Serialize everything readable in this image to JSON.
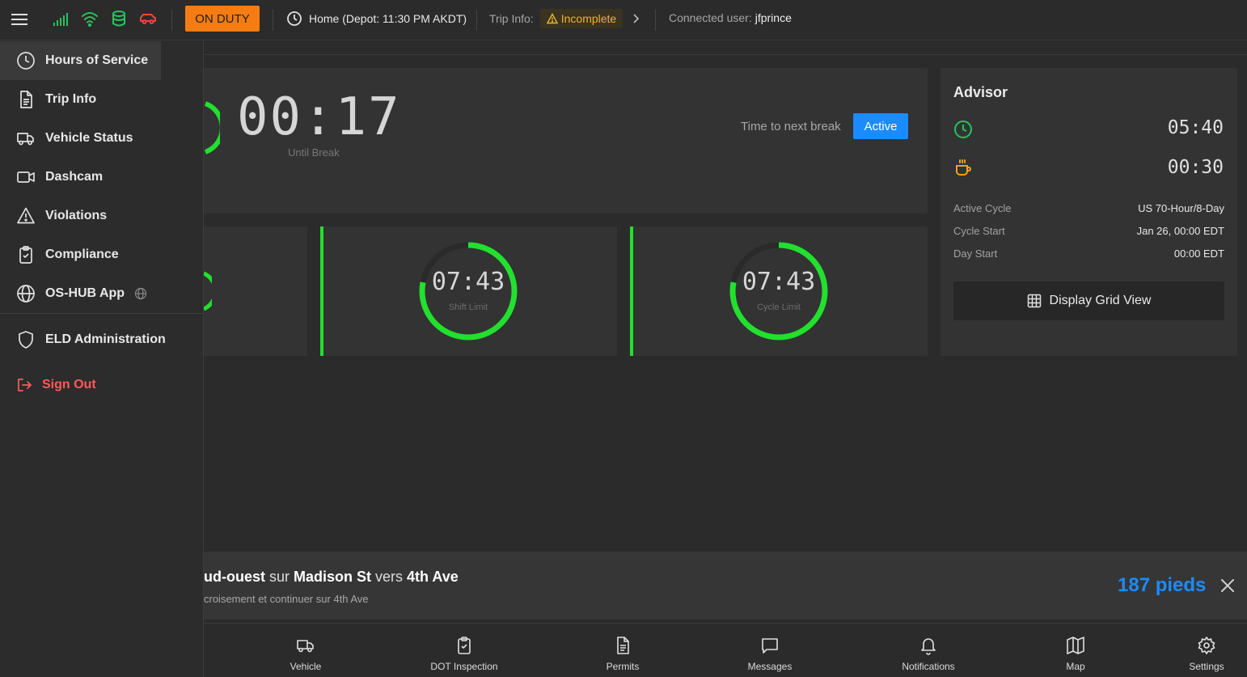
{
  "topbar": {
    "duty_status": "ON DUTY",
    "home_label": "Home (Depot: 11:30 PM AKDT)",
    "trip_info_label": "Trip Info:",
    "trip_status": "Incomplete",
    "connected_label": "Connected user:",
    "connected_user": "jfprince",
    "colors": {
      "duty": "#f57c12",
      "signal": "#22c55e",
      "warning": "#f0b429",
      "vehicle_alert": "#ef4444"
    }
  },
  "sidebar": {
    "items": [
      {
        "label": "Hours of Service",
        "icon": "clock-icon"
      },
      {
        "label": "Trip Info",
        "icon": "document-icon"
      },
      {
        "label": "Vehicle Status",
        "icon": "truck-icon"
      },
      {
        "label": "Dashcam",
        "icon": "video-camera-icon"
      },
      {
        "label": "Violations",
        "icon": "warning-icon"
      },
      {
        "label": "Compliance",
        "icon": "clipboard-check-icon"
      },
      {
        "label": "OS-HUB App",
        "icon": "globe-icon"
      },
      {
        "label": "ELD Administration",
        "icon": "shield-icon"
      }
    ],
    "sign_out": "Sign Out"
  },
  "hos": {
    "break_timer": "00:17",
    "break_label": "Until Break",
    "next_break_label": "Time to next break",
    "active_button": "Active",
    "shift": {
      "value": "07:43",
      "label": "Shift Limit",
      "progress": 0.78
    },
    "cycle": {
      "value": "07:43",
      "label": "Cycle Limit",
      "progress": 0.78
    },
    "accent": "#22e02e"
  },
  "advisor": {
    "title": "Advisor",
    "drive_time": "05:40",
    "break_time": "00:30",
    "rows": [
      {
        "key": "Active Cycle",
        "value": "US 70-Hour/8-Day"
      },
      {
        "key": "Cycle Start",
        "value": "Jan 26, 00:00 EDT"
      },
      {
        "key": "Day Start",
        "value": "00:00 EDT"
      }
    ],
    "grid_button": "Display Grid View"
  },
  "navigation": {
    "dir_prefix": "ud-ouest",
    "dir_sur": " sur ",
    "street": "Madison St",
    "dir_vers": " vers ",
    "target": "4th Ave",
    "sub": "croisement et continuer sur 4th Ave",
    "distance": "187 pieds"
  },
  "bottombar": {
    "items": [
      {
        "label": "Vehicle",
        "icon": "truck-icon"
      },
      {
        "label": "DOT Inspection",
        "icon": "clipboard-check-icon"
      },
      {
        "label": "Permits",
        "icon": "document-icon"
      },
      {
        "label": "Messages",
        "icon": "message-icon"
      },
      {
        "label": "Notifications",
        "icon": "bell-icon"
      },
      {
        "label": "Map",
        "icon": "map-icon"
      },
      {
        "label": "Settings",
        "icon": "gear-icon"
      }
    ]
  }
}
